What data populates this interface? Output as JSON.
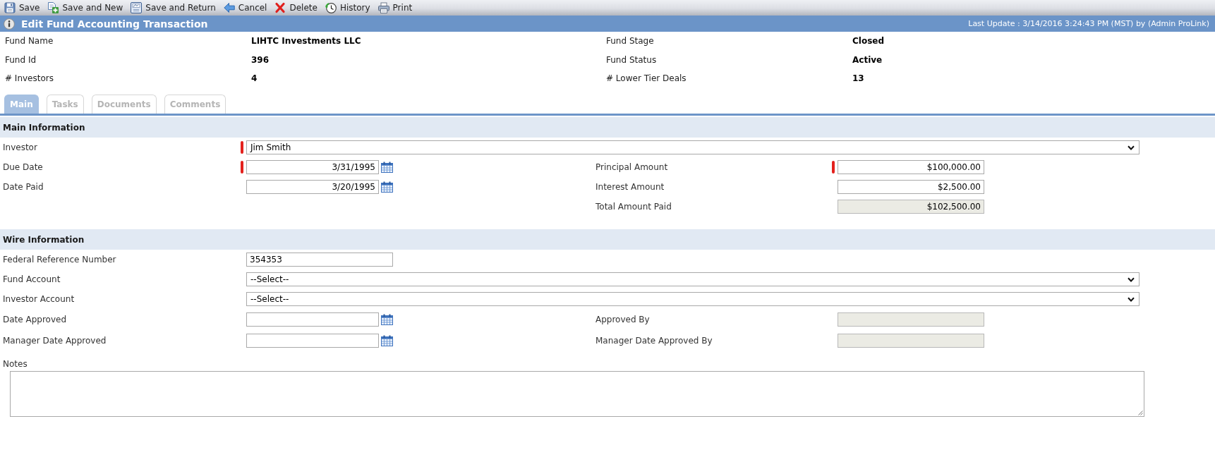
{
  "toolbar": [
    {
      "label": "Save",
      "kind": "save"
    },
    {
      "label": "Save and New",
      "kind": "save-new"
    },
    {
      "label": "Save and Return",
      "kind": "save-return"
    },
    {
      "label": "Cancel",
      "kind": "cancel"
    },
    {
      "label": "Delete",
      "kind": "delete"
    },
    {
      "label": "History",
      "kind": "history"
    },
    {
      "label": "Print",
      "kind": "print"
    }
  ],
  "header": {
    "title": "Edit Fund Accounting Transaction",
    "last_update": "Last Update : 3/14/2016 3:24:43 PM (MST) by (Admin ProLink)"
  },
  "summary": [
    {
      "label": "Fund Name",
      "value": "LIHTC Investments LLC"
    },
    {
      "label": "Fund Stage",
      "value": "Closed"
    },
    {
      "label": "Fund Id",
      "value": "396"
    },
    {
      "label": "Fund Status",
      "value": "Active"
    },
    {
      "label": "# Investors",
      "value": "4"
    },
    {
      "label": "# Lower Tier Deals",
      "value": "13"
    }
  ],
  "tabs": [
    {
      "label": "Main",
      "selected": true
    },
    {
      "label": "Tasks",
      "selected": false
    },
    {
      "label": "Documents",
      "selected": false
    },
    {
      "label": "Comments",
      "selected": false
    }
  ],
  "sections": [
    {
      "title": "Main Information",
      "rows": [
        {
          "left": {
            "label": "Investor",
            "kind": "select",
            "value": "Jim Smith",
            "required": true,
            "disabled": false
          }
        },
        {
          "left": {
            "label": "Due Date",
            "kind": "date",
            "value": "3/31/1995",
            "required": true,
            "disabled": false
          },
          "right": {
            "label": "Principal Amount",
            "kind": "amount",
            "value": "$100,000.00",
            "required": true,
            "disabled": false
          }
        },
        {
          "left": {
            "label": "Date Paid",
            "kind": "date",
            "value": "3/20/1995",
            "required": false,
            "disabled": false
          },
          "right": {
            "label": "Interest Amount",
            "kind": "amount",
            "value": "$2,500.00",
            "required": false,
            "disabled": false
          }
        },
        {
          "right": {
            "label": "Total Amount Paid",
            "kind": "amount",
            "value": "$102,500.00",
            "required": false,
            "disabled": true
          }
        }
      ]
    },
    {
      "title": "Wire Information",
      "rows": [
        {
          "left": {
            "label": "Federal Reference Number",
            "kind": "text",
            "value": "354353",
            "required": false,
            "disabled": false
          }
        },
        {
          "left": {
            "label": "Fund Account",
            "kind": "select",
            "value": "--Select--",
            "required": false,
            "disabled": false
          }
        },
        {
          "left": {
            "label": "Investor Account",
            "kind": "select",
            "value": "--Select--",
            "required": false,
            "disabled": false
          }
        },
        {
          "left": {
            "label": "Date Approved",
            "kind": "date",
            "required": false,
            "disabled": false
          },
          "right": {
            "label": "Approved By",
            "kind": "text",
            "required": false,
            "disabled": true
          }
        },
        {
          "left": {
            "label": "Manager Date Approved",
            "kind": "date",
            "required": false,
            "disabled": false
          },
          "right": {
            "label": "Manager Date Approved By",
            "kind": "text",
            "required": false,
            "disabled": true
          }
        }
      ]
    }
  ],
  "notes": {
    "label": "Notes"
  }
}
